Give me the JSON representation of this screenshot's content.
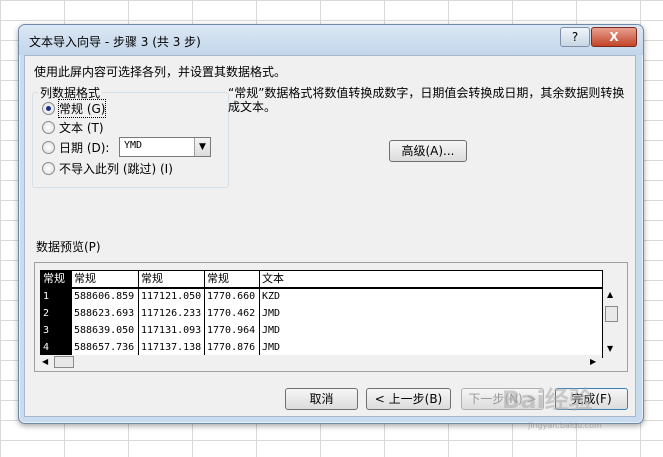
{
  "window": {
    "title": "文本导入向导 - 步骤 3 (共 3 步)",
    "help_label": "?",
    "close_label": "X"
  },
  "instruction": "使用此屏内容可选择各列，并设置其数据格式。",
  "column_format": {
    "legend": "列数据格式",
    "options": [
      {
        "label": "常规 (G)",
        "checked": true
      },
      {
        "label": "文本 (T)",
        "checked": false
      },
      {
        "label": "日期 (D):",
        "checked": false
      },
      {
        "label": "不导入此列 (跳过) (I)",
        "checked": false
      }
    ],
    "date_format": "YMD"
  },
  "description": "“常规”数据格式将数值转换成数字，日期值会转换成日期，其余数据则转换成文本。",
  "advanced_label": "高级(A)...",
  "preview": {
    "label": "数据预览(P)",
    "headers": [
      "常规",
      "常规",
      "常规",
      "常规",
      "文本"
    ],
    "rows": [
      [
        "1",
        "588606.859",
        "117121.050",
        "1770.660",
        "KZD"
      ],
      [
        "2",
        "588623.693",
        "117126.233",
        "1770.462",
        "JMD"
      ],
      [
        "3",
        "588639.050",
        "117131.093",
        "1770.964",
        "JMD"
      ],
      [
        "4",
        "588657.736",
        "117137.138",
        "1770.876",
        "JMD"
      ]
    ]
  },
  "buttons": {
    "cancel": "取消",
    "back": "< 上一步(B)",
    "next": "下一步(N) >",
    "finish": "完成(F)"
  },
  "watermark": {
    "text": "Bai经验",
    "sub": "jingyan.baidu.com"
  }
}
